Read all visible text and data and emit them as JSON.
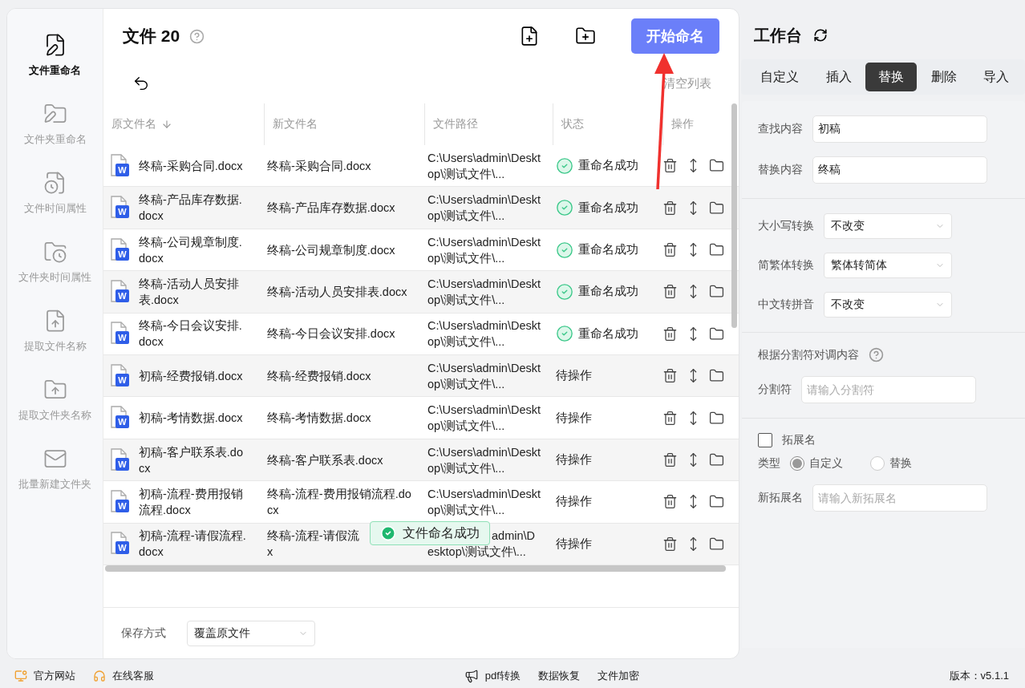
{
  "sidebar": {
    "items": [
      {
        "label": "文件重命名",
        "selected": true
      },
      {
        "label": "文件夹重命名",
        "selected": false
      },
      {
        "label": "文件时间属性",
        "selected": false
      },
      {
        "label": "文件夹时间属性",
        "selected": false
      },
      {
        "label": "提取文件名称",
        "selected": false
      },
      {
        "label": "提取文件夹名称",
        "selected": false
      },
      {
        "label": "批量新建文件夹",
        "selected": false
      }
    ]
  },
  "header": {
    "title": "文件",
    "count": "20",
    "start_button": "开始命名",
    "clear_button": "清空列表"
  },
  "table": {
    "columns": [
      {
        "label": "原文件名",
        "sorted": true
      },
      {
        "label": "新文件名",
        "sorted": false
      },
      {
        "label": "文件路径",
        "sorted": false
      },
      {
        "label": "状态",
        "sorted": false
      },
      {
        "label": "操作",
        "sorted": false
      }
    ],
    "rows": [
      {
        "badge": "W",
        "original": "终稿-采购合同.docx",
        "new": [
          "终稿-采购合同.docx"
        ],
        "path": [
          "C:\\Users\\admin\\Desktop\\测试文件\\..."
        ],
        "status": "重命名成功",
        "done": true
      },
      {
        "badge": "W",
        "original": "终稿-产品库存数据.docx",
        "new": [
          "终稿-产品库存数据.docx"
        ],
        "path": [
          "C:\\Users\\admin\\Desktop\\测试文件\\..."
        ],
        "status": "重命名成功",
        "done": true
      },
      {
        "badge": "W",
        "original": "终稿-公司规章制度.docx",
        "new": [
          "终稿-公司规章制度.docx"
        ],
        "path": [
          "C:\\Users\\admin\\Desktop\\测试文件\\..."
        ],
        "status": "重命名成功",
        "done": true
      },
      {
        "badge": "W",
        "original": "终稿-活动人员安排表.docx",
        "new": [
          "终稿-活动人员安排表.docx"
        ],
        "path": [
          "C:\\Users\\admin\\Desktop\\测试文件\\..."
        ],
        "status": "重命名成功",
        "done": true
      },
      {
        "badge": "W",
        "original": "终稿-今日会议安排.docx",
        "new": [
          "终稿-今日会议安排.docx"
        ],
        "path": [
          "C:\\Users\\admin\\Desktop\\测试文件\\..."
        ],
        "status": "重命名成功",
        "done": true
      },
      {
        "badge": "W",
        "original": "初稿-经费报销.docx",
        "new": [
          "终稿-经费报销.docx"
        ],
        "path": [
          "C:\\Users\\admin\\Desktop\\测试文件\\..."
        ],
        "status": "待操作",
        "done": false
      },
      {
        "badge": "W",
        "original": "初稿-考情数据.docx",
        "new": [
          "终稿-考情数据.docx"
        ],
        "path": [
          "C:\\Users\\admin\\Desktop\\测试文件\\..."
        ],
        "status": "待操作",
        "done": false
      },
      {
        "badge": "W",
        "original": "初稿-客户联系表.docx",
        "new": [
          "终稿-客户联系表.docx"
        ],
        "path": [
          "C:\\Users\\admin\\Desktop\\测试文件\\..."
        ],
        "status": "待操作",
        "done": false
      },
      {
        "badge": "W",
        "original": "初稿-流程-费用报销流程.docx",
        "new": [
          "终稿-流程-费用报销流程.docx"
        ],
        "path": [
          "C:\\Users\\admin\\Desktop\\测试文件\\..."
        ],
        "status": "待操作",
        "done": false
      },
      {
        "badge": "W",
        "original": "初稿-流程-请假流程.docx",
        "new": [
          "终稿-流程-请假流",
          "x"
        ],
        "path": [
          "admin\\D",
          "esktop\\测试文件\\..."
        ],
        "status": "待操作",
        "done": false
      }
    ]
  },
  "toast": {
    "text": "文件命名成功"
  },
  "save": {
    "label": "保存方式",
    "value": "覆盖原文件"
  },
  "workbench": {
    "title": "工作台",
    "tabs": [
      {
        "label": "自定义",
        "selected": false
      },
      {
        "label": "插入",
        "selected": false
      },
      {
        "label": "替换",
        "selected": true
      },
      {
        "label": "删除",
        "selected": false
      },
      {
        "label": "导入",
        "selected": false
      }
    ],
    "find": {
      "label": "查找内容",
      "value": "初稿"
    },
    "replace": {
      "label": "替换内容",
      "value": "终稿"
    },
    "selects": [
      {
        "label": "大小写转换",
        "value": "不改变"
      },
      {
        "label": "简繁体转换",
        "value": "繁体转简体"
      },
      {
        "label": "中文转拼音",
        "value": "不改变"
      }
    ],
    "separator_title": "根据分割符对调内容",
    "separator": {
      "label": "分割符",
      "placeholder": "请输入分割符"
    },
    "extension": {
      "label": "拓展名",
      "checked": false,
      "type_label": "类型",
      "types": [
        {
          "label": "自定义",
          "selected": true
        },
        {
          "label": "替换",
          "selected": false
        }
      ],
      "new_label": "新拓展名",
      "new_placeholder": "请输入新拓展名"
    }
  },
  "footer": {
    "left": [
      "官方网站",
      "在线客服"
    ],
    "center": [
      "pdf转换",
      "数据恢复",
      "文件加密"
    ],
    "version": "版本：v5.1.1"
  }
}
